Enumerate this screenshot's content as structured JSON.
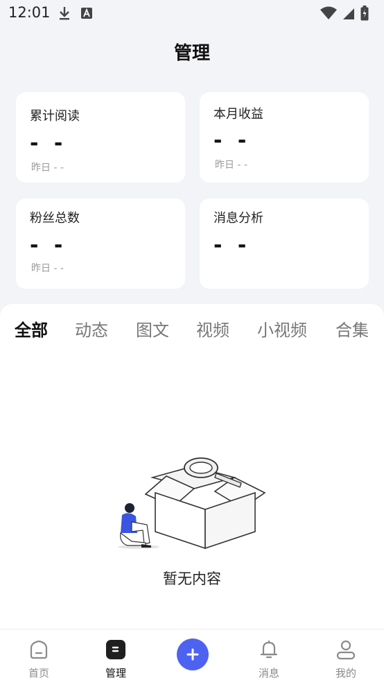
{
  "status_bar": {
    "time": "12:01"
  },
  "header": {
    "title": "管理"
  },
  "stats": [
    {
      "title": "累计阅读",
      "value": "- -",
      "sub": "昨日 - -"
    },
    {
      "title": "本月收益",
      "value": "- -",
      "sub": "昨日 - -"
    },
    {
      "title": "粉丝总数",
      "value": "- -",
      "sub": "昨日 - -"
    },
    {
      "title": "消息分析",
      "value": "- -"
    }
  ],
  "tabs": [
    {
      "label": "全部",
      "active": true
    },
    {
      "label": "动态"
    },
    {
      "label": "图文"
    },
    {
      "label": "视频"
    },
    {
      "label": "小视频"
    },
    {
      "label": "合集"
    }
  ],
  "empty_state": {
    "text": "暂无内容"
  },
  "bottom_nav": [
    {
      "label": "首页",
      "icon": "home-icon"
    },
    {
      "label": "管理",
      "icon": "manage-icon",
      "active": true
    },
    {
      "label": "",
      "icon": "add-icon"
    },
    {
      "label": "消息",
      "icon": "bell-icon"
    },
    {
      "label": "我的",
      "icon": "profile-icon"
    }
  ],
  "colors": {
    "accent": "#4e62f2",
    "background": "#f3f4f7"
  }
}
